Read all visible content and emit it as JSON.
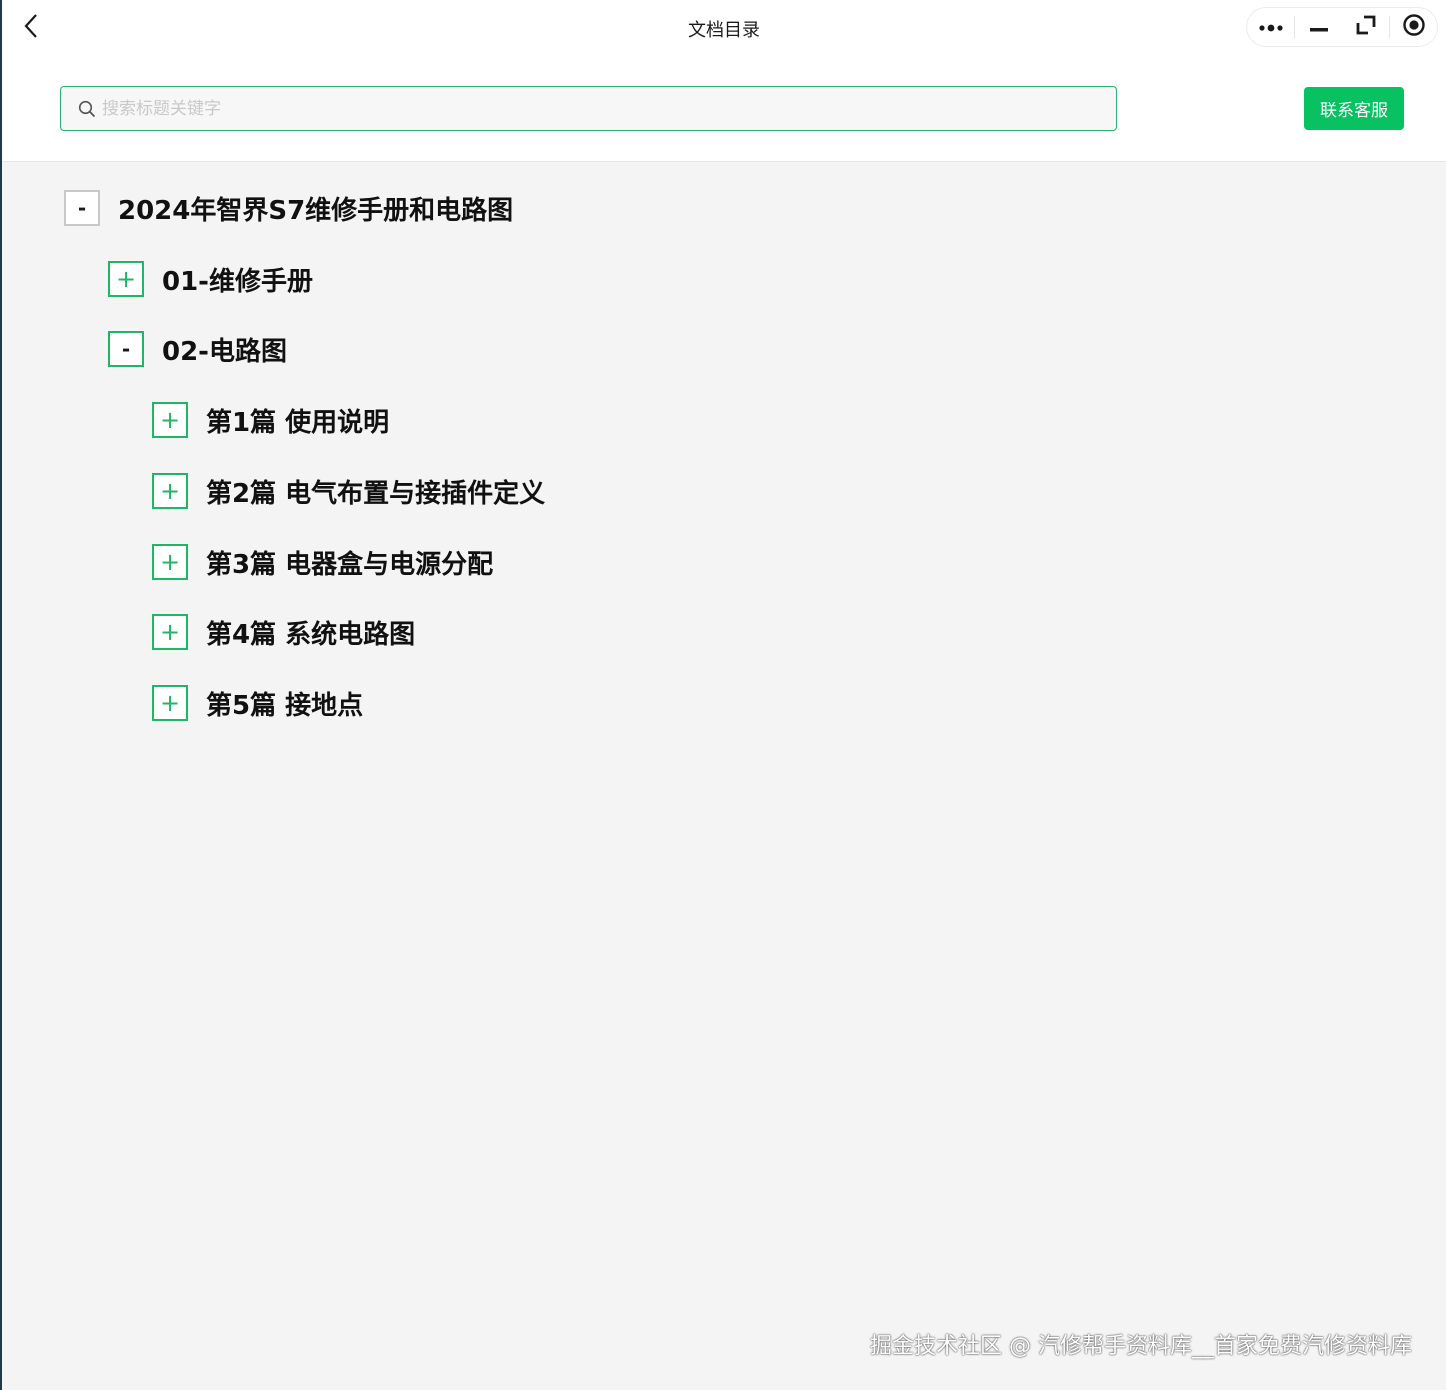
{
  "header": {
    "title": "文档目录",
    "back_icon": "chevron-left-icon",
    "capsule_icons": [
      "more-icon",
      "minimize-icon",
      "restore-icon",
      "close-circle-icon"
    ]
  },
  "search": {
    "placeholder": "搜索标题关键字",
    "value": "",
    "contact_label": "联系客服"
  },
  "tree": {
    "root": {
      "label": "2024年智界S7维修手册和电路图",
      "toggle": "-"
    },
    "children": [
      {
        "label": "01-维修手册",
        "toggle": "+"
      },
      {
        "label": "02-电路图",
        "toggle": "-"
      }
    ],
    "grandchildren": [
      {
        "label": "第1篇 使用说明",
        "toggle": "+"
      },
      {
        "label": "第2篇 电气布置与接插件定义",
        "toggle": "+"
      },
      {
        "label": "第3篇 电器盒与电源分配",
        "toggle": "+"
      },
      {
        "label": "第4篇 系统电路图",
        "toggle": "+"
      },
      {
        "label": "第5篇 接地点",
        "toggle": "+"
      }
    ]
  },
  "watermark": "掘金技术社区 @ 汽修帮手资料库__首家免费汽修资料库",
  "colors": {
    "accent": "#08c160",
    "border_green": "#1fb765",
    "background": "#f4f4f4"
  }
}
